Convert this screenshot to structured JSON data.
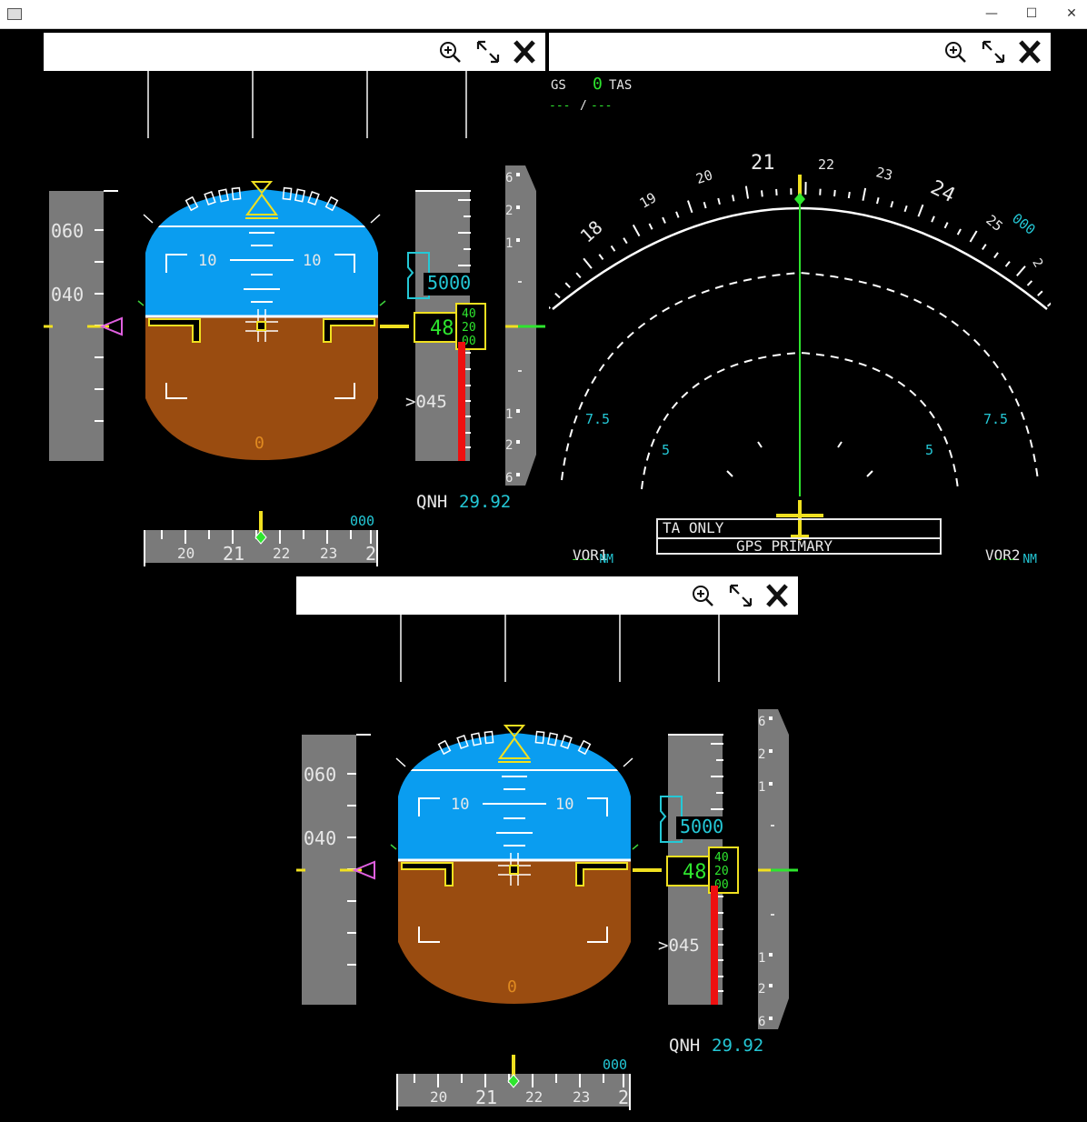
{
  "window": {
    "controls": {
      "minimize": "—",
      "maximize": "☐",
      "close": "✕"
    }
  },
  "panel_tools": [
    "zoom-in-icon",
    "expand-icon",
    "close-icon"
  ],
  "pfd": {
    "speed_tape": {
      "labels": [
        "060",
        "040"
      ]
    },
    "attitude": {
      "pitch_left": "10",
      "pitch_right": "10",
      "zero": "0"
    },
    "altitude": {
      "selected": "5000",
      "current": "48",
      "drum": [
        "40",
        "20",
        "00"
      ],
      "lower_label": ">045"
    },
    "vsi": {
      "top": [
        "6",
        "2",
        "1"
      ],
      "bottom": [
        "1",
        "2",
        "6"
      ]
    },
    "qnh_label": "QNH",
    "qnh_value": "29.92",
    "heading": {
      "selected": "000",
      "labels": [
        "20",
        "21",
        "22",
        "23",
        "2"
      ]
    }
  },
  "nd": {
    "gs_label": "GS",
    "gs_value": "0",
    "tas_label": "TAS",
    "gs_dash": "---",
    "tas_dash": "---",
    "heading_labels": [
      "18",
      "19",
      "20",
      "21",
      "22",
      "23",
      "24",
      "25",
      "2"
    ],
    "selected_heading": "000",
    "range_outer_left": "7.5",
    "range_outer_right": "7.5",
    "range_inner_left": "5",
    "range_inner_right": "5",
    "vor1": "VOR1",
    "vor2": "VOR2",
    "vor1_dist": "---",
    "vor2_dist": "---",
    "nm1": "NM",
    "nm2": "NM",
    "tcas_mode": "TA ONLY",
    "nav_status": "GPS PRIMARY"
  },
  "colors": {
    "sky": "#0a9df0",
    "ground": "#9a4c10",
    "tape": "#7a7a7a",
    "cyan": "#24c8d6",
    "green": "#2ee62e",
    "yellow": "#f0e020",
    "magenta": "#e060e0",
    "red": "#ee1010"
  }
}
